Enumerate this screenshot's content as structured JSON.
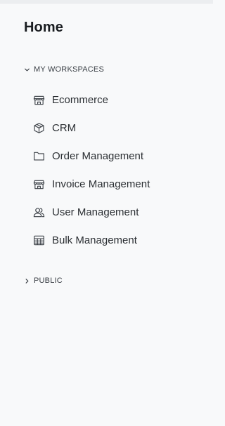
{
  "sidebar": {
    "title": "Home",
    "sections": {
      "workspaces": {
        "label": "MY WORKSPACES",
        "expanded": true,
        "items": [
          {
            "label": "Ecommerce",
            "icon": "store-icon"
          },
          {
            "label": "CRM",
            "icon": "box-icon"
          },
          {
            "label": "Order Management",
            "icon": "folder-icon"
          },
          {
            "label": "Invoice Management",
            "icon": "store-icon"
          },
          {
            "label": "User Management",
            "icon": "users-icon"
          },
          {
            "label": "Bulk Management",
            "icon": "table-icon"
          }
        ]
      },
      "public": {
        "label": "PUBLIC",
        "expanded": false
      }
    }
  },
  "colors": {
    "background": "#f8f9fa",
    "text": "#2b2f33",
    "icon": "#3b4046"
  }
}
